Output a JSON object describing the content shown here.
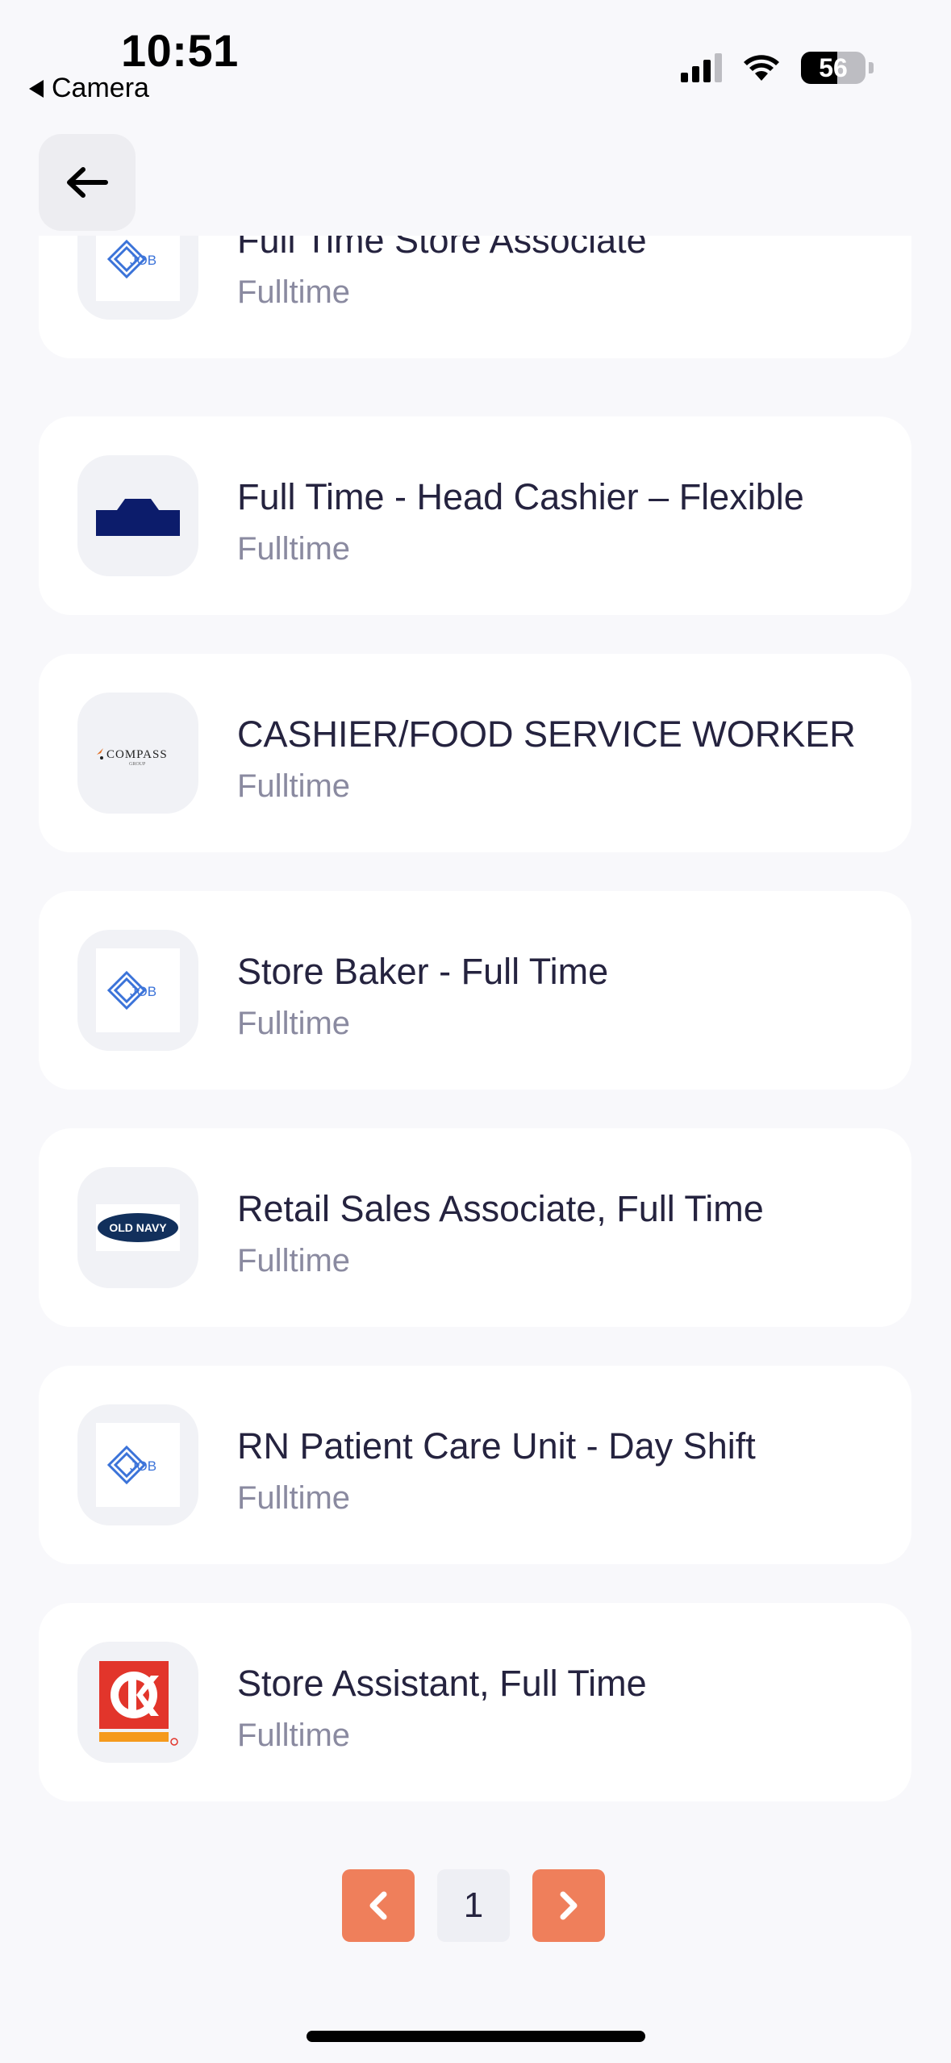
{
  "status_bar": {
    "time": "10:51",
    "back_app": "Camera",
    "battery": "56"
  },
  "jobs": [
    {
      "title": "Full Time Store Associate",
      "type": "Fulltime",
      "logo": "job-logo"
    },
    {
      "title": "Full Time - Head Cashier – Flexible",
      "type": "Fulltime",
      "logo": "navy-building-logo"
    },
    {
      "title": "CASHIER/FOOD SERVICE WORKER",
      "type": "Fulltime",
      "logo": "compass-logo",
      "logo_text": "COMPASS"
    },
    {
      "title": "Store Baker - Full Time",
      "type": "Fulltime",
      "logo": "job-logo"
    },
    {
      "title": "Retail Sales Associate, Full Time",
      "type": "Fulltime",
      "logo": "old-navy-logo",
      "logo_text": "OLD NAVY"
    },
    {
      "title": "RN Patient Care Unit - Day Shift",
      "type": "Fulltime",
      "logo": "job-logo"
    },
    {
      "title": "Store Assistant, Full Time",
      "type": "Fulltime",
      "logo": "circle-k-logo"
    }
  ],
  "pagination": {
    "current_page": "1"
  },
  "colors": {
    "accent": "#ef7f5b",
    "background": "#f8f8fb",
    "card": "#ffffff",
    "title": "#25233f",
    "subtitle": "#8a8aa0"
  }
}
